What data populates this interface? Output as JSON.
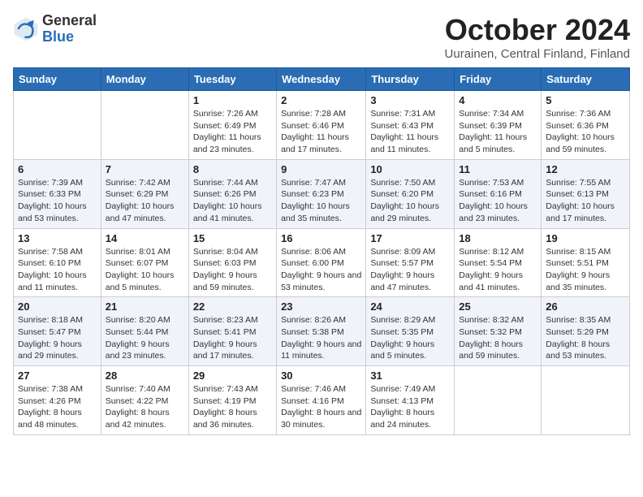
{
  "logo": {
    "general": "General",
    "blue": "Blue"
  },
  "title": "October 2024",
  "location": "Uurainen, Central Finland, Finland",
  "weekdays": [
    "Sunday",
    "Monday",
    "Tuesday",
    "Wednesday",
    "Thursday",
    "Friday",
    "Saturday"
  ],
  "weeks": [
    [
      {
        "day": "",
        "sunrise": "",
        "sunset": "",
        "daylight": ""
      },
      {
        "day": "",
        "sunrise": "",
        "sunset": "",
        "daylight": ""
      },
      {
        "day": "1",
        "sunrise": "Sunrise: 7:26 AM",
        "sunset": "Sunset: 6:49 PM",
        "daylight": "Daylight: 11 hours and 23 minutes."
      },
      {
        "day": "2",
        "sunrise": "Sunrise: 7:28 AM",
        "sunset": "Sunset: 6:46 PM",
        "daylight": "Daylight: 11 hours and 17 minutes."
      },
      {
        "day": "3",
        "sunrise": "Sunrise: 7:31 AM",
        "sunset": "Sunset: 6:43 PM",
        "daylight": "Daylight: 11 hours and 11 minutes."
      },
      {
        "day": "4",
        "sunrise": "Sunrise: 7:34 AM",
        "sunset": "Sunset: 6:39 PM",
        "daylight": "Daylight: 11 hours and 5 minutes."
      },
      {
        "day": "5",
        "sunrise": "Sunrise: 7:36 AM",
        "sunset": "Sunset: 6:36 PM",
        "daylight": "Daylight: 10 hours and 59 minutes."
      }
    ],
    [
      {
        "day": "6",
        "sunrise": "Sunrise: 7:39 AM",
        "sunset": "Sunset: 6:33 PM",
        "daylight": "Daylight: 10 hours and 53 minutes."
      },
      {
        "day": "7",
        "sunrise": "Sunrise: 7:42 AM",
        "sunset": "Sunset: 6:29 PM",
        "daylight": "Daylight: 10 hours and 47 minutes."
      },
      {
        "day": "8",
        "sunrise": "Sunrise: 7:44 AM",
        "sunset": "Sunset: 6:26 PM",
        "daylight": "Daylight: 10 hours and 41 minutes."
      },
      {
        "day": "9",
        "sunrise": "Sunrise: 7:47 AM",
        "sunset": "Sunset: 6:23 PM",
        "daylight": "Daylight: 10 hours and 35 minutes."
      },
      {
        "day": "10",
        "sunrise": "Sunrise: 7:50 AM",
        "sunset": "Sunset: 6:20 PM",
        "daylight": "Daylight: 10 hours and 29 minutes."
      },
      {
        "day": "11",
        "sunrise": "Sunrise: 7:53 AM",
        "sunset": "Sunset: 6:16 PM",
        "daylight": "Daylight: 10 hours and 23 minutes."
      },
      {
        "day": "12",
        "sunrise": "Sunrise: 7:55 AM",
        "sunset": "Sunset: 6:13 PM",
        "daylight": "Daylight: 10 hours and 17 minutes."
      }
    ],
    [
      {
        "day": "13",
        "sunrise": "Sunrise: 7:58 AM",
        "sunset": "Sunset: 6:10 PM",
        "daylight": "Daylight: 10 hours and 11 minutes."
      },
      {
        "day": "14",
        "sunrise": "Sunrise: 8:01 AM",
        "sunset": "Sunset: 6:07 PM",
        "daylight": "Daylight: 10 hours and 5 minutes."
      },
      {
        "day": "15",
        "sunrise": "Sunrise: 8:04 AM",
        "sunset": "Sunset: 6:03 PM",
        "daylight": "Daylight: 9 hours and 59 minutes."
      },
      {
        "day": "16",
        "sunrise": "Sunrise: 8:06 AM",
        "sunset": "Sunset: 6:00 PM",
        "daylight": "Daylight: 9 hours and 53 minutes."
      },
      {
        "day": "17",
        "sunrise": "Sunrise: 8:09 AM",
        "sunset": "Sunset: 5:57 PM",
        "daylight": "Daylight: 9 hours and 47 minutes."
      },
      {
        "day": "18",
        "sunrise": "Sunrise: 8:12 AM",
        "sunset": "Sunset: 5:54 PM",
        "daylight": "Daylight: 9 hours and 41 minutes."
      },
      {
        "day": "19",
        "sunrise": "Sunrise: 8:15 AM",
        "sunset": "Sunset: 5:51 PM",
        "daylight": "Daylight: 9 hours and 35 minutes."
      }
    ],
    [
      {
        "day": "20",
        "sunrise": "Sunrise: 8:18 AM",
        "sunset": "Sunset: 5:47 PM",
        "daylight": "Daylight: 9 hours and 29 minutes."
      },
      {
        "day": "21",
        "sunrise": "Sunrise: 8:20 AM",
        "sunset": "Sunset: 5:44 PM",
        "daylight": "Daylight: 9 hours and 23 minutes."
      },
      {
        "day": "22",
        "sunrise": "Sunrise: 8:23 AM",
        "sunset": "Sunset: 5:41 PM",
        "daylight": "Daylight: 9 hours and 17 minutes."
      },
      {
        "day": "23",
        "sunrise": "Sunrise: 8:26 AM",
        "sunset": "Sunset: 5:38 PM",
        "daylight": "Daylight: 9 hours and 11 minutes."
      },
      {
        "day": "24",
        "sunrise": "Sunrise: 8:29 AM",
        "sunset": "Sunset: 5:35 PM",
        "daylight": "Daylight: 9 hours and 5 minutes."
      },
      {
        "day": "25",
        "sunrise": "Sunrise: 8:32 AM",
        "sunset": "Sunset: 5:32 PM",
        "daylight": "Daylight: 8 hours and 59 minutes."
      },
      {
        "day": "26",
        "sunrise": "Sunrise: 8:35 AM",
        "sunset": "Sunset: 5:29 PM",
        "daylight": "Daylight: 8 hours and 53 minutes."
      }
    ],
    [
      {
        "day": "27",
        "sunrise": "Sunrise: 7:38 AM",
        "sunset": "Sunset: 4:26 PM",
        "daylight": "Daylight: 8 hours and 48 minutes."
      },
      {
        "day": "28",
        "sunrise": "Sunrise: 7:40 AM",
        "sunset": "Sunset: 4:22 PM",
        "daylight": "Daylight: 8 hours and 42 minutes."
      },
      {
        "day": "29",
        "sunrise": "Sunrise: 7:43 AM",
        "sunset": "Sunset: 4:19 PM",
        "daylight": "Daylight: 8 hours and 36 minutes."
      },
      {
        "day": "30",
        "sunrise": "Sunrise: 7:46 AM",
        "sunset": "Sunset: 4:16 PM",
        "daylight": "Daylight: 8 hours and 30 minutes."
      },
      {
        "day": "31",
        "sunrise": "Sunrise: 7:49 AM",
        "sunset": "Sunset: 4:13 PM",
        "daylight": "Daylight: 8 hours and 24 minutes."
      },
      {
        "day": "",
        "sunrise": "",
        "sunset": "",
        "daylight": ""
      },
      {
        "day": "",
        "sunrise": "",
        "sunset": "",
        "daylight": ""
      }
    ]
  ]
}
